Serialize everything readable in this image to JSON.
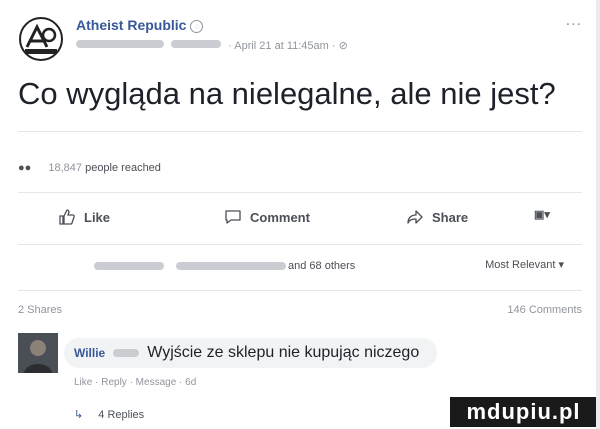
{
  "post": {
    "page_name": "Atheist Republic",
    "timestamp": "April 21 at 11:45am",
    "more": "...",
    "text": "Co wygląda na nielegalne, ale nie jest?"
  },
  "reach": {
    "count": "18,847",
    "label": "people reached"
  },
  "actions": {
    "like": "Like",
    "comment": "Comment",
    "share": "Share"
  },
  "reactions": {
    "others": "and 68 others",
    "sort": "Most Relevant"
  },
  "stats": {
    "shares": "2 Shares",
    "comments": "146 Comments"
  },
  "comment": {
    "author": "Willie",
    "text": "Wyjście ze sklepu nie kupując niczego",
    "links": "Like · Reply · Message · 6d",
    "replies": "4 Replies"
  },
  "watermark": "mdupiu.pl",
  "colors": {
    "link": "#365899",
    "secondary": "#90949c",
    "bubble": "#f2f3f5"
  }
}
